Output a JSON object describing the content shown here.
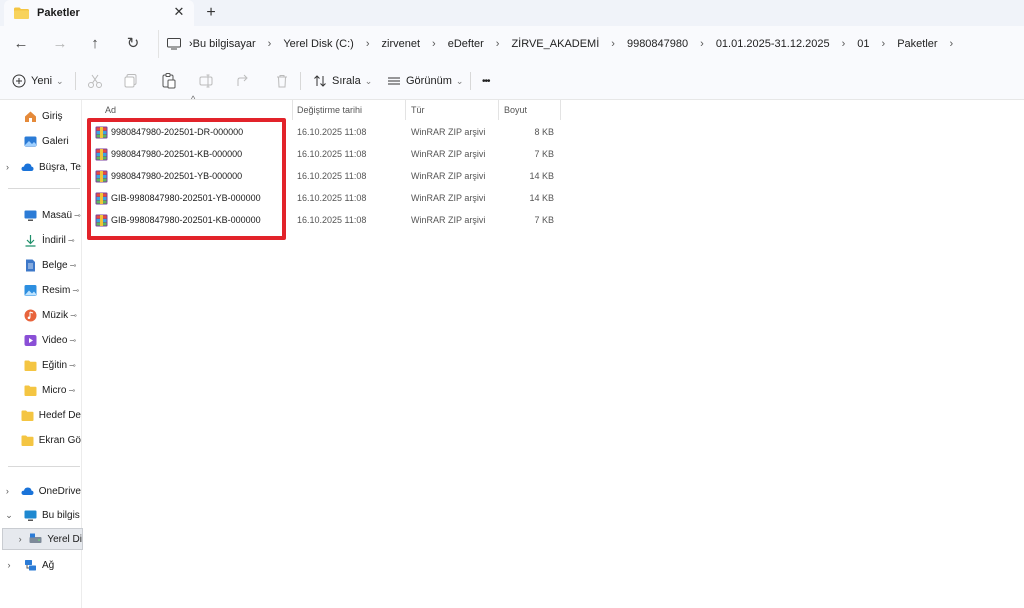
{
  "window": {
    "tab_title": "Paketler",
    "tab_close_glyph": "✕",
    "new_tab_glyph": "+"
  },
  "nav": {
    "back_glyph": "←",
    "forward_glyph": "→",
    "up_glyph": "↑",
    "refresh_glyph": "↻"
  },
  "breadcrumb": [
    "Bu bilgisayar",
    "Yerel Disk (C:)",
    "zirvenet",
    "eDefter",
    "ZİRVE_AKADEMİ",
    "9980847980",
    "01.01.2025-31.12.2025",
    "01",
    "Paketler"
  ],
  "breadcrumb_separator": "›",
  "toolbar": {
    "new_label": "Yeni",
    "sort_label": "Sırala",
    "view_label": "Görünüm",
    "more_glyph": "•••",
    "dropdown_glyph": "⌄",
    "icons": [
      "cut-icon",
      "copy-icon",
      "paste-icon",
      "rename-icon",
      "share-icon",
      "delete-icon"
    ]
  },
  "sidebar": {
    "quick": [
      {
        "label": "Giriş",
        "icon": "home-icon"
      },
      {
        "label": "Galeri",
        "icon": "gallery-icon"
      },
      {
        "label": "Büşra, Te",
        "icon": "cloud-icon",
        "expandable": true
      }
    ],
    "pinned": [
      {
        "label": "Masaü",
        "icon": "desktop-icon"
      },
      {
        "label": "İndiril",
        "icon": "download-icon"
      },
      {
        "label": "Belge",
        "icon": "document-icon"
      },
      {
        "label": "Resim",
        "icon": "pictures-icon"
      },
      {
        "label": "Müzik",
        "icon": "music-icon"
      },
      {
        "label": "Video",
        "icon": "video-icon"
      },
      {
        "label": "Eğitin",
        "icon": "folder-icon"
      },
      {
        "label": "Micro",
        "icon": "folder-icon"
      },
      {
        "label": "Hedef De",
        "icon": "folder-icon",
        "no_pin": true
      },
      {
        "label": "Ekran Gö",
        "icon": "folder-icon",
        "no_pin": true
      }
    ],
    "pin_glyph": "📌",
    "tree": [
      {
        "label": "OneDrive",
        "icon": "onedrive-icon",
        "chev": "›"
      },
      {
        "label": "Bu bilgis",
        "icon": "monitor-icon",
        "chev": "⌄"
      },
      {
        "label": "Yerel Di",
        "icon": "drive-icon",
        "chev": "›",
        "selected": true,
        "indent": true
      },
      {
        "label": "Ağ",
        "icon": "network-icon",
        "chev": "›"
      }
    ]
  },
  "columns": {
    "name": "Ad",
    "date": "Değiştirme tarihi",
    "type": "Tür",
    "size": "Boyut",
    "sort_caret": "^"
  },
  "files": [
    {
      "name": "9980847980-202501-DR-000000",
      "date": "16.10.2025 11:08",
      "type": "WinRAR ZIP arşivi",
      "size": "8 KB"
    },
    {
      "name": "9980847980-202501-KB-000000",
      "date": "16.10.2025 11:08",
      "type": "WinRAR ZIP arşivi",
      "size": "7 KB"
    },
    {
      "name": "9980847980-202501-YB-000000",
      "date": "16.10.2025 11:08",
      "type": "WinRAR ZIP arşivi",
      "size": "14 KB"
    },
    {
      "name": "GIB-9980847980-202501-YB-000000",
      "date": "16.10.2025 11:08",
      "type": "WinRAR ZIP arşivi",
      "size": "14 KB"
    },
    {
      "name": "GIB-9980847980-202501-KB-000000",
      "date": "16.10.2025 11:08",
      "type": "WinRAR ZIP arşivi",
      "size": "7 KB"
    }
  ],
  "colors": {
    "highlight": "#e2232a",
    "folder": "#f4c542",
    "accent": "#1a73d9"
  }
}
